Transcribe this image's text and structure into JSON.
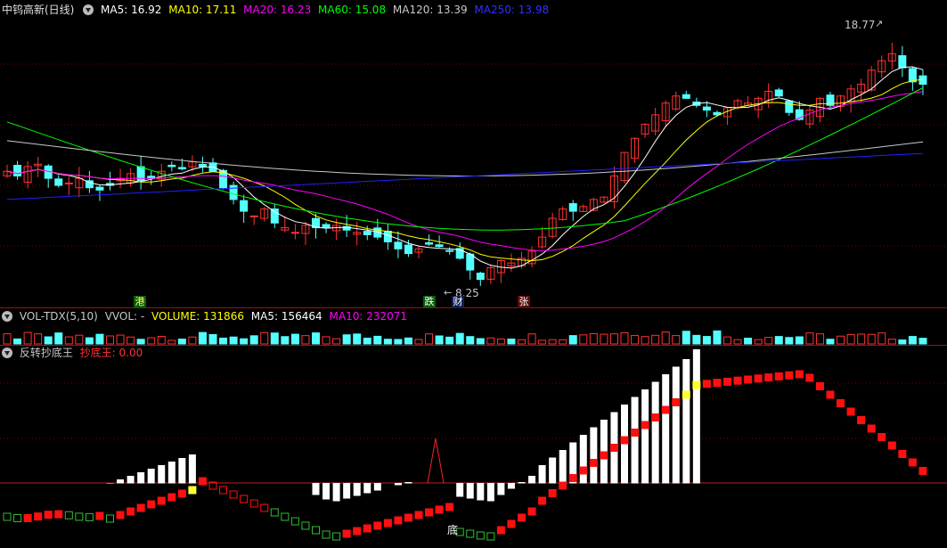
{
  "header": {
    "stock_name": "中钨高新(日线)",
    "ma5": "MA5: 16.92",
    "ma10": "MA10: 17.11",
    "ma20": "MA20: 16.23",
    "ma60": "MA60: 15.08",
    "ma120": "MA120: 13.39",
    "ma250": "MA250: 13.98"
  },
  "volume_header": {
    "name": "VOL-TDX(5,10)",
    "vvol": "VVOL: -",
    "volume": "VOLUME: 131866",
    "ma5": "MA5: 156464",
    "ma10": "MA10: 232071"
  },
  "indicator_header": {
    "name": "反转抄底王",
    "value": "抄底王: 0.00"
  },
  "annotations": {
    "high": "18.77",
    "low": "8.25",
    "tag_gang": "港",
    "tag_die": "跌",
    "tag_cai": "财",
    "tag_zhang": "张",
    "tag_di": "底"
  },
  "colors": {
    "up": "#ff3232",
    "down": "#54ffff",
    "ma5": "#ffffff",
    "ma10": "#ffff00",
    "ma20": "#ff00ff",
    "ma60": "#00ff00",
    "ma120": "#c8c8c8",
    "ma250": "#2020ff",
    "grid": "#7a0000"
  },
  "chart_data": {
    "type": "candlestick",
    "title": "中钨高新(日线)",
    "high_label": 18.77,
    "low_label": 8.25,
    "moving_averages": {
      "MA5": 16.92,
      "MA10": 17.11,
      "MA20": 16.23,
      "MA60": 15.08,
      "MA120": 13.39,
      "MA250": 13.98
    },
    "close_approx": [
      13.2,
      13.0,
      13.4,
      13.5,
      12.9,
      12.6,
      12.7,
      12.9,
      12.5,
      12.4,
      12.6,
      12.9,
      13.1,
      12.8,
      12.9,
      13.2,
      13.4,
      13.3,
      13.6,
      13.4,
      13.2,
      12.5,
      12.0,
      11.5,
      11.3,
      11.6,
      11.0,
      10.8,
      10.6,
      10.9,
      10.8,
      10.8,
      10.9,
      10.7,
      10.6,
      10.5,
      10.4,
      10.2,
      9.9,
      9.7,
      9.9,
      10.1,
      10.0,
      9.8,
      9.5,
      9.0,
      8.6,
      9.1,
      9.4,
      9.3,
      9.5,
      9.8,
      10.4,
      11.2,
      11.6,
      11.5,
      11.7,
      12.0,
      12.1,
      13.0,
      14.0,
      14.6,
      15.2,
      15.6,
      16.1,
      16.4,
      16.3,
      16.0,
      15.8,
      15.6,
      15.9,
      16.2,
      16.1,
      16.3,
      16.6,
      16.4,
      15.7,
      15.4,
      15.8,
      16.3,
      16.0,
      16.4,
      16.7,
      16.9,
      17.5,
      17.9,
      18.2,
      17.6,
      17.0,
      16.9
    ],
    "volume": {
      "VOLUME": 131866,
      "MA5": 156464,
      "MA10": 232071
    },
    "indicator": {
      "name": "抄底王",
      "value": 0.0
    }
  }
}
